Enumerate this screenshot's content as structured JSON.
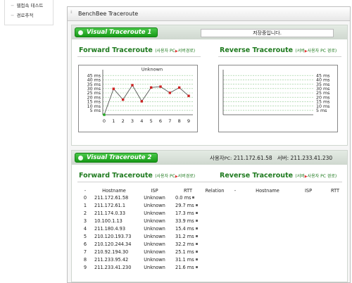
{
  "sidebar": {
    "items": [
      {
        "label": "웹접속 테스트"
      },
      {
        "label": "경로추적"
      }
    ]
  },
  "window": {
    "title": "BenchBee Traceroute"
  },
  "panel1": {
    "badge": "Visual Traceroute 1",
    "status": "저장중입니다.",
    "forward_title": "Forward Traceroute",
    "forward_sub": "(사용자 PC",
    "forward_sub2": "서버경로)",
    "reverse_title": "Reverse Traceroute",
    "reverse_sub": "(서버",
    "reverse_sub2": "사용자 PC 경로)"
  },
  "panel2": {
    "badge": "Visual Traceroute 2",
    "user_pc_label": "사용자",
    "user_pc_prefix": "PC:",
    "user_pc_ip": "211.172.61.58",
    "server_label": "서버:",
    "server_ip": "211.233.41.230",
    "forward_title": "Forward Traceroute",
    "forward_sub": "(사용자 PC",
    "forward_sub2": "서버경로)",
    "reverse_title": "Reverse Traceroute",
    "reverse_sub": "(서버",
    "reverse_sub2": "사용자 PC 경로)"
  },
  "table": {
    "columns": [
      "-",
      "Hostname",
      "ISP",
      "RTT",
      "Relation",
      "-",
      "Hostname",
      "ISP",
      "RTT"
    ],
    "rows": [
      {
        "idx": "0",
        "host": "211.172.61.58",
        "isp": "Unknown",
        "rtt": "0.0 ms"
      },
      {
        "idx": "1",
        "host": "211.172.61.1",
        "isp": "Unknown",
        "rtt": "29.7 ms"
      },
      {
        "idx": "2",
        "host": "211.174.0.33",
        "isp": "Unknown",
        "rtt": "17.3 ms"
      },
      {
        "idx": "3",
        "host": "10.100.1.13",
        "isp": "Unknown",
        "rtt": "33.9 ms"
      },
      {
        "idx": "4",
        "host": "211.180.4.93",
        "isp": "Unknown",
        "rtt": "15.4 ms"
      },
      {
        "idx": "5",
        "host": "210.120.193.73",
        "isp": "Unknown",
        "rtt": "31.2 ms"
      },
      {
        "idx": "6",
        "host": "210.120.244.34",
        "isp": "Unknown",
        "rtt": "32.2 ms"
      },
      {
        "idx": "7",
        "host": "210.92.194.30",
        "isp": "Unknown",
        "rtt": "25.1 ms"
      },
      {
        "idx": "8",
        "host": "211.233.95.42",
        "isp": "Unknown",
        "rtt": "31.1 ms"
      },
      {
        "idx": "9",
        "host": "211.233.41.230",
        "isp": "Unknown",
        "rtt": "21.6 ms"
      }
    ]
  },
  "colors": {
    "accent_green": "#1e7a1e",
    "badge_green": "#179a17",
    "line_red": "#cc2222",
    "first_point_green": "#22aa22"
  },
  "chart_data": [
    {
      "type": "line",
      "label": "Unknown",
      "x": [
        0,
        1,
        2,
        3,
        4,
        5,
        6,
        7,
        8,
        9
      ],
      "values": [
        0.0,
        29.7,
        17.3,
        33.9,
        15.4,
        31.2,
        32.2,
        25.1,
        31.1,
        21.6
      ],
      "y_ticks": [
        "45 ms",
        "40 ms",
        "35 ms",
        "30 ms",
        "25 ms",
        "20 ms",
        "15 ms",
        "10 ms",
        "5 ms"
      ],
      "x_ticks": [
        "0",
        "1",
        "2",
        "3",
        "4",
        "5",
        "6",
        "7",
        "8",
        "9"
      ],
      "ylim": [
        0,
        50
      ],
      "grid": true,
      "y_axis_side": "left"
    },
    {
      "type": "line",
      "x": [],
      "values": [],
      "y_ticks": [
        "45 ms",
        "40 ms",
        "35 ms",
        "30 ms",
        "25 ms",
        "20 ms",
        "15 ms",
        "10 ms",
        "5 ms"
      ],
      "ylim": [
        0,
        50
      ],
      "grid": true,
      "y_axis_side": "right"
    }
  ]
}
